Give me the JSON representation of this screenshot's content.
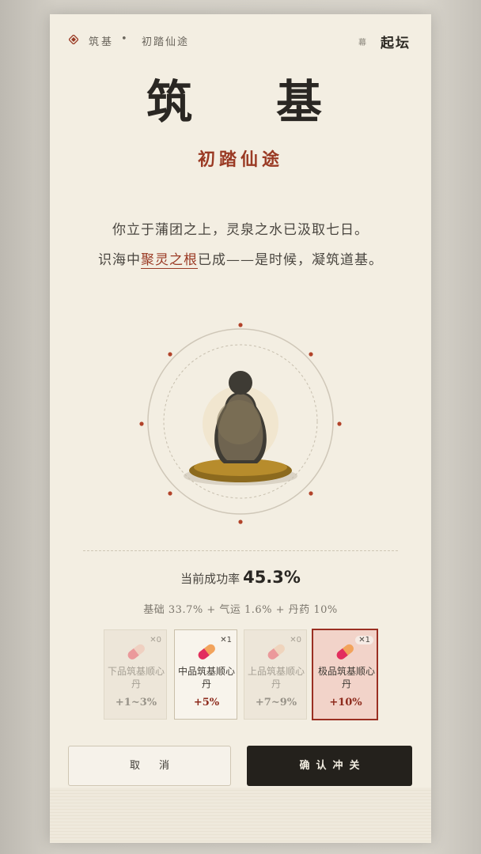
{
  "header": {
    "realm": "筑基",
    "separator": "•",
    "stage": "初踏仙途",
    "brand_small": "幕",
    "brand_main": "起坛"
  },
  "title": {
    "left": "筑",
    "right": "基",
    "subtitle": "初踏仙途"
  },
  "narrative": {
    "line1": "你立于蒲团之上，灵泉之水已汲取七日。",
    "line2_before": "识海中",
    "line2_highlight": "聚灵之根",
    "line2_after": "已成——是时候，凝筑道基。"
  },
  "success": {
    "label": "当前成功率",
    "value": "45.3%",
    "breakdown": "基础 33.7% + 气运 1.6% + 丹药 10%"
  },
  "pills": [
    {
      "name": "下品筑基顺心丹",
      "qty": "✕0",
      "bonus": "+1~3%",
      "state": "disabled"
    },
    {
      "name": "中品筑基顺心丹",
      "qty": "✕1",
      "bonus": "+5%",
      "state": "available"
    },
    {
      "name": "上品筑基顺心丹",
      "qty": "✕0",
      "bonus": "+7~9%",
      "state": "disabled"
    },
    {
      "name": "极品筑基顺心丹",
      "qty": "✕1",
      "bonus": "+10%",
      "state": "selected"
    }
  ],
  "actions": {
    "cancel": "取消",
    "confirm": "确认冲关"
  },
  "colors": {
    "accent": "#9a3a24",
    "card_bg": "#f3eee2",
    "confirm_bg": "#24211c",
    "selected_bg": "#f2d3c9"
  },
  "icons": {
    "header": "diamond-icon",
    "emblem": "gourd-emblem",
    "pill": "capsule-icon"
  }
}
